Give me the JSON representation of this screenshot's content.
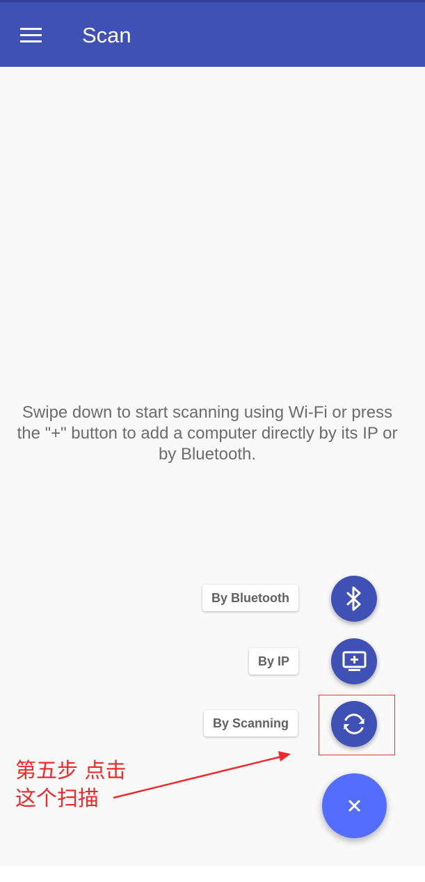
{
  "app_bar": {
    "title": "Scan",
    "menu_icon": "hamburger-menu-icon",
    "color": "#3f51b5"
  },
  "empty_state": {
    "message": "Swipe down to start scanning using Wi-Fi or press the \"+\" button to add a computer directly by its IP or by Bluetooth."
  },
  "fab_menu": {
    "items": [
      {
        "label": "By Bluetooth",
        "icon": "bluetooth-icon"
      },
      {
        "label": "By IP",
        "icon": "monitor-add-icon"
      },
      {
        "label": "By Scanning",
        "icon": "refresh-icon"
      }
    ],
    "main_icon": "close-icon",
    "main_color": "#536dfe",
    "mini_color": "#3f51b5"
  },
  "annotation": {
    "line1": "第五步 点击",
    "line2": "这个扫描",
    "color": "#f0282a"
  }
}
